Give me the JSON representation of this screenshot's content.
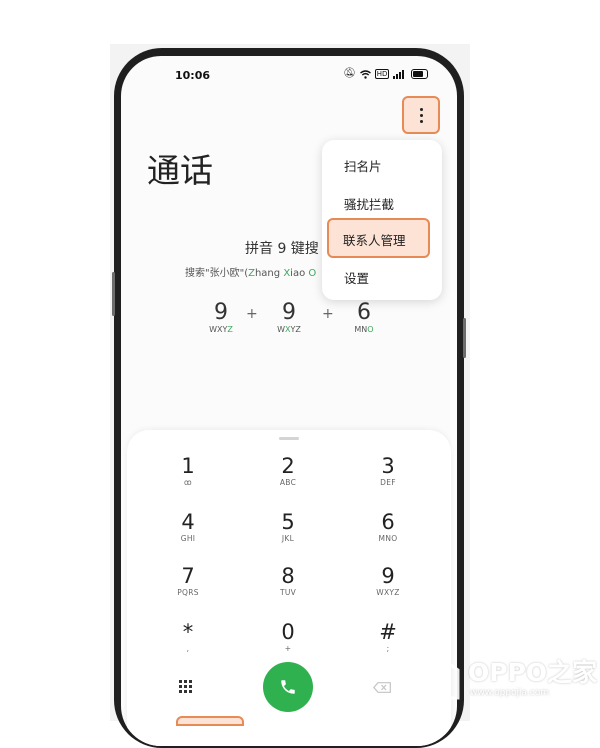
{
  "status_bar": {
    "time": "10:06",
    "icons": [
      "mute-icon",
      "wifi-icon",
      "hd-icon",
      "signal-icon",
      "battery-icon"
    ]
  },
  "header": {
    "title": "通话",
    "more_icon": "more-vertical-icon"
  },
  "menu": {
    "items": [
      "扫名片",
      "骚扰拦截",
      "联系人管理",
      "设置"
    ],
    "highlighted": "联系人管理"
  },
  "tip": {
    "title": "拼音 9 键搜",
    "subtitle_prefix": "搜索\"张小欧\"(",
    "subtitle_z": "Z",
    "subtitle_zh": "hang ",
    "subtitle_x": "X",
    "subtitle_xi": "iao ",
    "subtitle_o": "O"
  },
  "pinyin_keys": [
    {
      "digit": "9",
      "letters_prefix": "WXY",
      "letters_hl": "Z"
    },
    {
      "digit": "9",
      "letters_prefix": "W",
      "letters_hl": "X",
      "letters_suffix": "YZ"
    },
    {
      "digit": "6",
      "letters_prefix": "MN",
      "letters_hl": "O"
    }
  ],
  "plus_sign": "+",
  "keypad": {
    "keys": [
      {
        "digit": "1",
        "letters": "ꝏ"
      },
      {
        "digit": "2",
        "letters": "ABC"
      },
      {
        "digit": "3",
        "letters": "DEF"
      },
      {
        "digit": "4",
        "letters": "GHI"
      },
      {
        "digit": "5",
        "letters": "JKL"
      },
      {
        "digit": "6",
        "letters": "MNO"
      },
      {
        "digit": "7",
        "letters": "PQRS"
      },
      {
        "digit": "8",
        "letters": "TUV"
      },
      {
        "digit": "9",
        "letters": "WXYZ"
      },
      {
        "digit": "*",
        "letters": ","
      },
      {
        "digit": "0",
        "letters": "+"
      },
      {
        "digit": "#",
        "letters": ";"
      }
    ],
    "grid_icon": "dialpad-icon",
    "call_icon": "phone-icon",
    "delete_icon": "backspace-icon"
  },
  "watermark": {
    "brand": "OPPO之家",
    "url": "www.oppojia.com"
  },
  "colors": {
    "highlight_border": "#e88a55",
    "highlight_fill": "#fde3d6",
    "call_green": "#2fb14f",
    "pinyin_green": "#3aa85a"
  }
}
